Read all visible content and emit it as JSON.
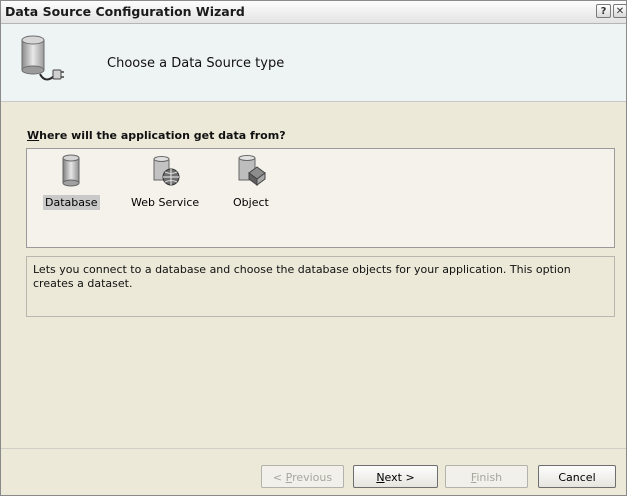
{
  "window": {
    "title": "Data Source Configuration Wizard",
    "help_glyph": "?",
    "close_glyph": "✕"
  },
  "header": {
    "title": "Choose a Data Source type",
    "icon": "database-plug-icon"
  },
  "question": {
    "accel": "W",
    "rest": "here will the application get data from?"
  },
  "choices": [
    {
      "label": "Database",
      "icon": "database-icon",
      "selected": true
    },
    {
      "label": "Web Service",
      "icon": "web-service-icon",
      "selected": false
    },
    {
      "label": "Object",
      "icon": "object-icon",
      "selected": false
    }
  ],
  "description": "Lets you connect to a database and choose the database objects for your application. This option creates a dataset.",
  "buttons": {
    "previous": {
      "pre": "< ",
      "accel": "P",
      "rest": "revious",
      "enabled": false
    },
    "next": {
      "pre": "",
      "accel": "N",
      "rest": "ext >",
      "enabled": true
    },
    "finish": {
      "pre": "",
      "accel": "F",
      "rest": "inish",
      "enabled": false
    },
    "cancel": {
      "label": "Cancel",
      "enabled": true
    }
  }
}
